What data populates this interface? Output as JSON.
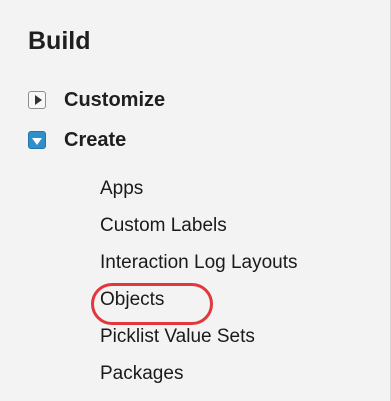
{
  "sidebar": {
    "title": "Build",
    "groups": [
      {
        "label": "Customize",
        "state": "collapsed"
      },
      {
        "label": "Create",
        "state": "expanded"
      }
    ],
    "create_items": [
      {
        "label": "Apps"
      },
      {
        "label": "Custom Labels"
      },
      {
        "label": "Interaction Log Layouts"
      },
      {
        "label": "Objects",
        "highlighted": true
      },
      {
        "label": "Picklist Value Sets"
      },
      {
        "label": "Packages"
      }
    ]
  },
  "colors": {
    "panel_background": "#f3f3f4",
    "expanded_toggle": "#2f8fc9",
    "highlight_ring": "#e0383c"
  }
}
